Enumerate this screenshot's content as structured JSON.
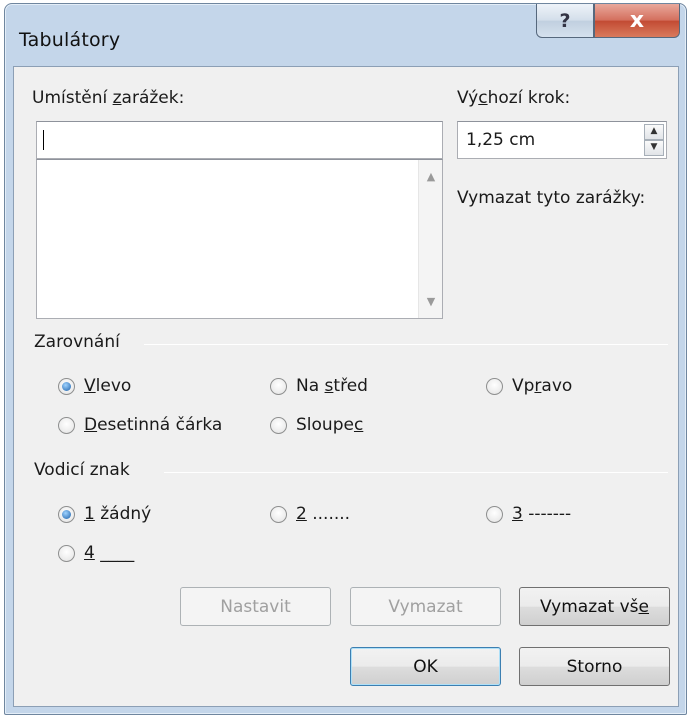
{
  "window": {
    "title": "Tabulátory",
    "help_glyph": "?",
    "close_glyph": "x"
  },
  "tab_positions": {
    "label_pre": "Umístění ",
    "label_ul": "z",
    "label_post": "arážek:",
    "input_value": "",
    "list_items": []
  },
  "default_stop": {
    "label_pre": "Vý",
    "label_ul": "c",
    "label_post": "hozí krok:",
    "value": "1,25 cm"
  },
  "clear_label": "Vymazat tyto zarážky:",
  "alignment": {
    "title": "Zarovnání",
    "options": [
      {
        "ul": "V",
        "rest_pre": "",
        "rest": "levo",
        "checked": true
      },
      {
        "pre": "Na ",
        "ul": "s",
        "rest": "třed",
        "checked": false
      },
      {
        "pre": "Vp",
        "ul": "r",
        "rest": "avo",
        "checked": false
      },
      {
        "ul": "D",
        "rest": "esetinná čárka",
        "checked": false
      },
      {
        "pre": "Sloupe",
        "ul": "c",
        "rest": "",
        "checked": false
      }
    ]
  },
  "leader": {
    "title": "Vodicí znak",
    "options": [
      {
        "ul": "1",
        "rest": " žádný",
        "checked": true
      },
      {
        "ul": "2",
        "rest": " .......",
        "checked": false
      },
      {
        "ul": "3",
        "rest": " -------",
        "checked": false
      },
      {
        "ul": "4",
        "rest": " ____",
        "checked": false
      }
    ]
  },
  "buttons": {
    "set": "Nastavit",
    "clear": "Vymazat",
    "clear_all_pre": "Vymazat vš",
    "clear_all_ul": "e",
    "ok": "OK",
    "cancel": "Storno"
  }
}
